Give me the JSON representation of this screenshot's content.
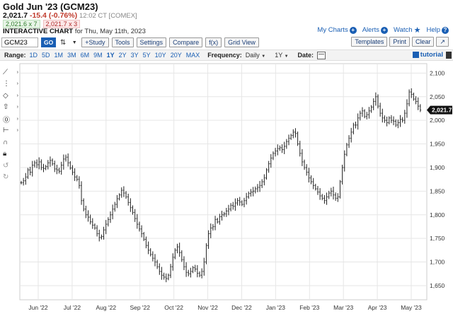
{
  "header": {
    "title": "Gold Jun '23 (GCM23)",
    "last": "2,021.7",
    "change": "-15.4 (-0.76%)",
    "time": "12:02 CT [COMEX]",
    "bid": "2,021.6 x 7",
    "ask": "2,021.7 x 3",
    "interactive_label": "INTERACTIVE CHART",
    "interactive_date": "for Thu, May 11th, 2023"
  },
  "top_links": {
    "my_charts": "My Charts",
    "alerts": "Alerts",
    "watch": "Watch",
    "help": "Help"
  },
  "toolbar": {
    "symbol": "GCM23",
    "go": "GO",
    "study": "+Study",
    "tools": "Tools",
    "settings": "Settings",
    "compare": "Compare",
    "fx": "f(x)",
    "grid_view": "Grid View",
    "templates": "Templates",
    "print": "Print",
    "clear": "Clear"
  },
  "range_bar": {
    "range_label": "Range:",
    "ranges": [
      "1D",
      "5D",
      "1M",
      "3M",
      "6M",
      "9M",
      "1Y",
      "2Y",
      "3Y",
      "5Y",
      "10Y",
      "20Y",
      "MAX"
    ],
    "active_range": "1Y",
    "frequency_label": "Frequency:",
    "frequency_value": "Daily",
    "period_value": "1Y",
    "date_label": "Date:",
    "tutorial": "tutorial"
  },
  "side_tools": [
    "line-tool-icon",
    "fib-tool-icon",
    "shape-tool-icon",
    "arrow-tool-icon",
    "text-tool-icon",
    "measure-tool-icon",
    "magnet-icon",
    "lock-icon",
    "undo-icon",
    "redo-icon"
  ],
  "colors": {
    "accent": "#1a5fb4",
    "down": "#c0392b",
    "up": "#2f7d2c",
    "bar": "#222222"
  },
  "chart_data": {
    "type": "ohlc",
    "frequency": "daily",
    "ylim": [
      1620,
      2120
    ],
    "yticks": [
      1650,
      1700,
      1750,
      1800,
      1850,
      1900,
      1950,
      2000,
      2050,
      2100
    ],
    "ytick_labels": [
      "1,650",
      "1,700",
      "1,750",
      "1,800",
      "1,850",
      "1,900",
      "1,950",
      "2,000",
      "2,050",
      "2,100"
    ],
    "xticks": [
      "Jun '22",
      "Jul '22",
      "Aug '22",
      "Sep '22",
      "Oct '22",
      "Nov '22",
      "Dec '22",
      "Jan '23",
      "Feb '23",
      "Mar '23",
      "Apr '23",
      "May '23"
    ],
    "last_price_label": "2,021.7",
    "last_price": 2021.7,
    "closes": [
      1868,
      1872,
      1880,
      1895,
      1890,
      1905,
      1910,
      1906,
      1912,
      1900,
      1898,
      1902,
      1910,
      1915,
      1908,
      1897,
      1895,
      1892,
      1905,
      1918,
      1922,
      1910,
      1899,
      1890,
      1880,
      1875,
      1862,
      1830,
      1812,
      1800,
      1795,
      1785,
      1778,
      1772,
      1760,
      1752,
      1754,
      1768,
      1780,
      1790,
      1800,
      1812,
      1822,
      1834,
      1842,
      1852,
      1846,
      1838,
      1826,
      1815,
      1805,
      1792,
      1780,
      1770,
      1760,
      1748,
      1735,
      1725,
      1716,
      1708,
      1700,
      1690,
      1680,
      1672,
      1668,
      1665,
      1672,
      1690,
      1710,
      1725,
      1732,
      1720,
      1705,
      1690,
      1678,
      1675,
      1680,
      1688,
      1685,
      1676,
      1672,
      1680,
      1700,
      1735,
      1760,
      1772,
      1775,
      1790,
      1785,
      1796,
      1800,
      1802,
      1808,
      1812,
      1820,
      1818,
      1825,
      1830,
      1827,
      1822,
      1830,
      1838,
      1845,
      1848,
      1850,
      1855,
      1858,
      1862,
      1870,
      1878,
      1895,
      1908,
      1920,
      1930,
      1935,
      1940,
      1942,
      1938,
      1945,
      1955,
      1962,
      1968,
      1975,
      1972,
      1950,
      1930,
      1912,
      1900,
      1890,
      1878,
      1870,
      1862,
      1855,
      1848,
      1840,
      1835,
      1830,
      1838,
      1846,
      1850,
      1842,
      1835,
      1838,
      1870,
      1900,
      1928,
      1948,
      1962,
      1975,
      1990,
      1990,
      2005,
      2015,
      2020,
      2008,
      2012,
      2020,
      2028,
      2040,
      2050,
      2030,
      2015,
      2005,
      2000,
      1995,
      2005,
      2000,
      1998,
      1990,
      1995,
      2002,
      2000,
      2015,
      2035,
      2060,
      2055,
      2045,
      2040,
      2030,
      2021.7
    ]
  }
}
